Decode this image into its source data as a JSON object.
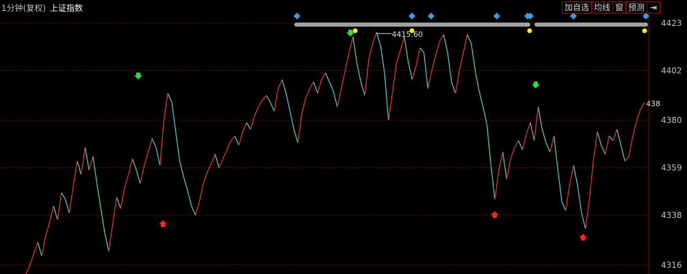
{
  "header": {
    "period": "1分钟(复权)",
    "name": "上证指数"
  },
  "toolbar": {
    "add_watchlist": "加自选",
    "ma_lines": "均线",
    "window": "窗",
    "forecast": "预测",
    "exit_icon": "exit-arrow-icon"
  },
  "colors": {
    "background": "#000000",
    "up": "#ff3030",
    "down": "#40e0d0",
    "grid": "#8b0000",
    "axis_text": "#c0c0c0"
  },
  "chart_data": {
    "type": "line",
    "title": "上证指数",
    "ylim": [
      4312,
      4426
    ],
    "y_ticks": [
      "4423",
      "4402",
      "4380",
      "4359",
      "4338",
      "4316"
    ],
    "last_value_label": "438",
    "peak_label": "4415.60",
    "series": [
      {
        "values": [
          4312,
          4316,
          4321,
          4326,
          4320,
          4329,
          4335,
          4342,
          4336,
          4348,
          4345,
          4339,
          4351,
          4362,
          4356,
          4368,
          4358,
          4364,
          4352,
          4341,
          4330,
          4322,
          4334,
          4346,
          4341,
          4350,
          4356,
          4363,
          4358,
          4352,
          4360,
          4366,
          4372,
          4368,
          4360,
          4380,
          4392,
          4388,
          4375,
          4362,
          4355,
          4349,
          4342,
          4338,
          4344,
          4352,
          4357,
          4361,
          4365,
          4359,
          4363,
          4367,
          4371,
          4373,
          4369,
          4375,
          4379,
          4376,
          4382,
          4386,
          4389,
          4391,
          4388,
          4384,
          4394,
          4398,
          4392,
          4384,
          4376,
          4370,
          4383,
          4390,
          4394,
          4397,
          4392,
          4398,
          4401,
          4397,
          4393,
          4386,
          4394,
          4402,
          4410,
          4417,
          4405,
          4397,
          4391,
          4407,
          4414,
          4419,
          4413,
          4401,
          4380,
          4392,
          4405,
          4411,
          4417,
          4406,
          4398,
          4404,
          4412,
          4410,
          4394,
          4402,
          4409,
          4415,
          4418,
          4410,
          4397,
          4392,
          4402,
          4410,
          4418,
          4414,
          4402,
          4393,
          4386,
          4378,
          4360,
          4345,
          4358,
          4366,
          4354,
          4363,
          4368,
          4371,
          4367,
          4374,
          4379,
          4371,
          4386,
          4376,
          4370,
          4366,
          4373,
          4358,
          4344,
          4340,
          4352,
          4360,
          4351,
          4339,
          4332,
          4345,
          4362,
          4375,
          4369,
          4365,
          4373,
          4371,
          4376,
          4369,
          4362,
          4364,
          4373,
          4380,
          4385,
          4388
        ],
        "color": "#ff3030"
      }
    ],
    "trade_markers": [
      {
        "type": "sell",
        "value": 4399
      },
      {
        "type": "buy",
        "value": 4334
      },
      {
        "type": "sell",
        "value": 4418
      },
      {
        "type": "buy",
        "value": 4338
      },
      {
        "type": "sell",
        "value": 4395
      },
      {
        "type": "buy",
        "value": 4328
      }
    ],
    "grid": true
  }
}
